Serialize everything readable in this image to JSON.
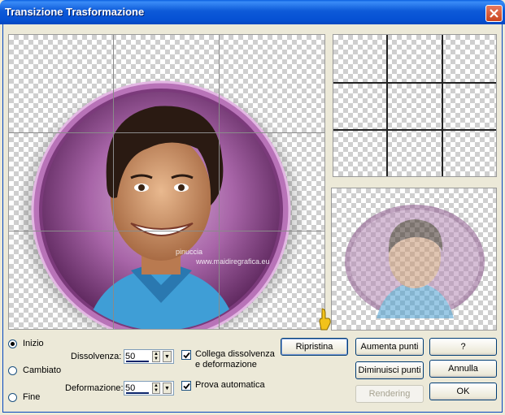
{
  "window": {
    "title": "Transizione Trasformazione"
  },
  "main_preview": {
    "watermark_line1": "pinuccia",
    "watermark_line2": "www.maidiregrafica.eu"
  },
  "mode": {
    "options": [
      {
        "label": "Inizio",
        "selected": true
      },
      {
        "label": "Cambiato",
        "selected": false
      },
      {
        "label": "Fine",
        "selected": false
      }
    ]
  },
  "dissolve": {
    "label": "Dissolvenza:",
    "value": "50"
  },
  "deform": {
    "label": "Deformazione:",
    "value": "50"
  },
  "options": {
    "link_label_1": "Collega dissolvenza",
    "link_label_2": "e deformazione",
    "link_checked": true,
    "auto_preview_label": "Prova automatica",
    "auto_preview_checked": true
  },
  "buttons": {
    "reset": "Ripristina",
    "add_points": "Aumenta punti",
    "help": "?",
    "remove_points": "Diminuisci punti",
    "cancel": "Annulla",
    "rendering": "Rendering",
    "ok": "OK"
  },
  "colors": {
    "title_bar": "#0a5fe0",
    "frame_purple": "#a05ea0",
    "shirt_blue": "#3f9ed6"
  }
}
